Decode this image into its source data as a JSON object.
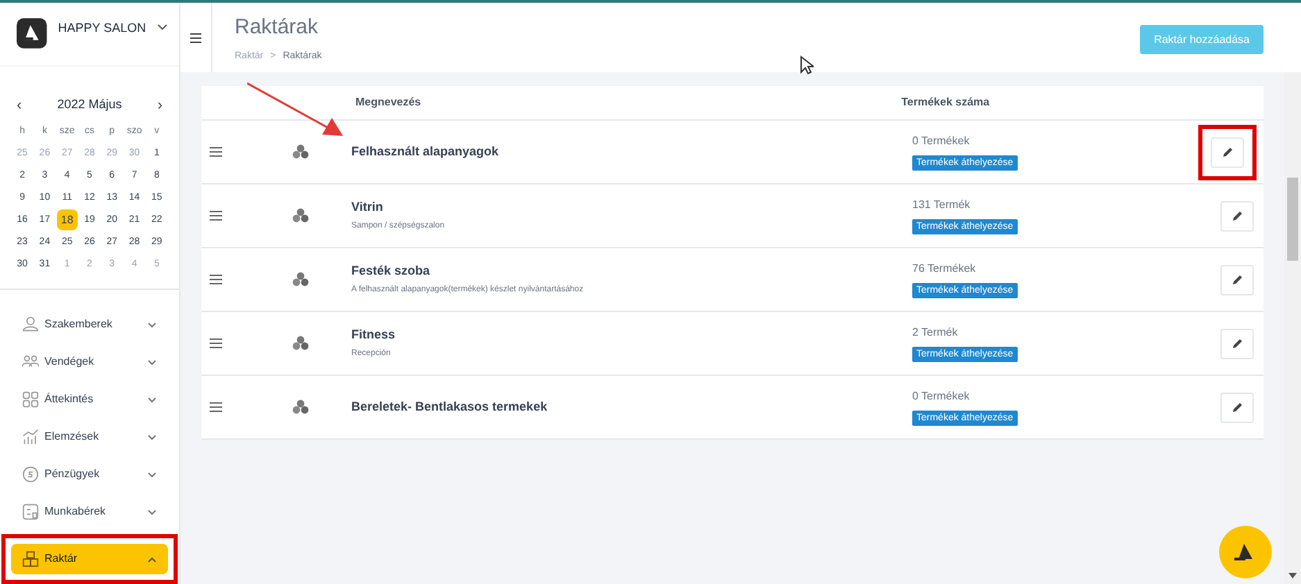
{
  "sidebar": {
    "brand": "HAPPY SALON",
    "calendar": {
      "title": "2022 Május",
      "prev": "‹",
      "next": "›",
      "weekdays": [
        "h",
        "k",
        "sze",
        "cs",
        "p",
        "szo",
        "v"
      ],
      "days": [
        {
          "label": "25",
          "muted": true,
          "selected": false
        },
        {
          "label": "26",
          "muted": true,
          "selected": false
        },
        {
          "label": "27",
          "muted": true,
          "selected": false
        },
        {
          "label": "28",
          "muted": true,
          "selected": false
        },
        {
          "label": "29",
          "muted": true,
          "selected": false
        },
        {
          "label": "30",
          "muted": true,
          "selected": false
        },
        {
          "label": "1",
          "muted": false,
          "selected": false
        },
        {
          "label": "2",
          "muted": false,
          "selected": false
        },
        {
          "label": "3",
          "muted": false,
          "selected": false
        },
        {
          "label": "4",
          "muted": false,
          "selected": false
        },
        {
          "label": "5",
          "muted": false,
          "selected": false
        },
        {
          "label": "6",
          "muted": false,
          "selected": false
        },
        {
          "label": "7",
          "muted": false,
          "selected": false
        },
        {
          "label": "8",
          "muted": false,
          "selected": false
        },
        {
          "label": "9",
          "muted": false,
          "selected": false
        },
        {
          "label": "10",
          "muted": false,
          "selected": false
        },
        {
          "label": "11",
          "muted": false,
          "selected": false
        },
        {
          "label": "12",
          "muted": false,
          "selected": false
        },
        {
          "label": "13",
          "muted": false,
          "selected": false
        },
        {
          "label": "14",
          "muted": false,
          "selected": false
        },
        {
          "label": "15",
          "muted": false,
          "selected": false
        },
        {
          "label": "16",
          "muted": false,
          "selected": false
        },
        {
          "label": "17",
          "muted": false,
          "selected": false
        },
        {
          "label": "18",
          "muted": false,
          "selected": true
        },
        {
          "label": "19",
          "muted": false,
          "selected": false
        },
        {
          "label": "20",
          "muted": false,
          "selected": false
        },
        {
          "label": "21",
          "muted": false,
          "selected": false
        },
        {
          "label": "22",
          "muted": false,
          "selected": false
        },
        {
          "label": "23",
          "muted": false,
          "selected": false
        },
        {
          "label": "24",
          "muted": false,
          "selected": false
        },
        {
          "label": "25",
          "muted": false,
          "selected": false
        },
        {
          "label": "26",
          "muted": false,
          "selected": false
        },
        {
          "label": "27",
          "muted": false,
          "selected": false
        },
        {
          "label": "28",
          "muted": false,
          "selected": false
        },
        {
          "label": "29",
          "muted": false,
          "selected": false
        },
        {
          "label": "30",
          "muted": false,
          "selected": false
        },
        {
          "label": "31",
          "muted": false,
          "selected": false
        },
        {
          "label": "1",
          "muted": true,
          "selected": false
        },
        {
          "label": "2",
          "muted": true,
          "selected": false
        },
        {
          "label": "3",
          "muted": true,
          "selected": false
        },
        {
          "label": "4",
          "muted": true,
          "selected": false
        },
        {
          "label": "5",
          "muted": true,
          "selected": false
        }
      ]
    },
    "items": [
      {
        "label": "Szakemberek",
        "selected": false,
        "expanded": false,
        "highlighted": false
      },
      {
        "label": "Vendégek",
        "selected": false,
        "expanded": false,
        "highlighted": false
      },
      {
        "label": "Áttekintés",
        "selected": false,
        "expanded": false,
        "highlighted": false
      },
      {
        "label": "Elemzések",
        "selected": false,
        "expanded": false,
        "highlighted": false
      },
      {
        "label": "Pénzügyek",
        "selected": false,
        "expanded": false,
        "highlighted": false
      },
      {
        "label": "Munkabérek",
        "selected": false,
        "expanded": false,
        "highlighted": false
      },
      {
        "label": "Raktár",
        "selected": true,
        "expanded": true,
        "highlighted": true
      }
    ]
  },
  "header": {
    "title": "Raktárak",
    "breadcrumb": [
      "Raktár",
      "Raktárak"
    ],
    "separator": ">",
    "add_button": "Raktár hozzáadása"
  },
  "table": {
    "columns": [
      "Megnevezés",
      "Termékek száma"
    ],
    "rows": [
      {
        "name": "Felhasznált alapanyagok",
        "description": "",
        "count": "0 Termékek",
        "move_button": "Termékek áthelyezése",
        "highlighted": true
      },
      {
        "name": "Vitrin",
        "description": "Sampon / szépségszalon",
        "count": "131 Termék",
        "move_button": "Termékek áthelyezése",
        "highlighted": false
      },
      {
        "name": "Festék szoba",
        "description": "A felhasznált alapanyagok(termékek) készlet nyilvántartásához",
        "count": "76 Termékek",
        "move_button": "Termékek áthelyezése",
        "highlighted": false
      },
      {
        "name": "Fitness",
        "description": "Recepción",
        "count": "2 Termék",
        "move_button": "Termékek áthelyezése",
        "highlighted": false
      },
      {
        "name": "Bereletek- Bentlakasos termekek",
        "description": "",
        "count": "0 Termékek",
        "move_button": "Termékek áthelyezése",
        "highlighted": false
      }
    ]
  }
}
